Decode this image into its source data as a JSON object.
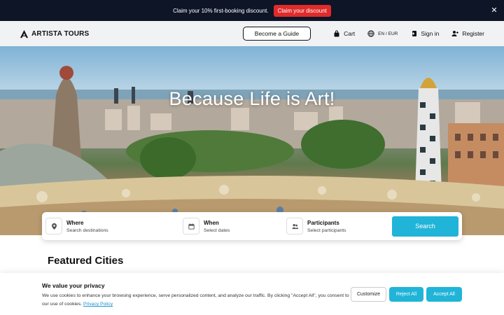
{
  "promo": {
    "text": "Claim your 10% first-booking discount.",
    "button": "Claim your discount",
    "close_icon": "close-icon"
  },
  "header": {
    "logo_text": "ARTISTA TOURS",
    "become_guide": "Become a Guide",
    "cart": "Cart",
    "locale": "EN / EUR",
    "sign_in": "Sign in",
    "register": "Register"
  },
  "hero": {
    "title": "Because Life is Art!"
  },
  "search": {
    "where_label": "Where",
    "where_sub": "Search destinations",
    "when_label": "When",
    "when_sub": "Select dates",
    "participants_label": "Participants",
    "participants_sub": "Select participants",
    "button": "Search"
  },
  "featured": {
    "title": "Featured Cities"
  },
  "cookie": {
    "title": "We value your privacy",
    "text": "We use cookies to enhance your browsing experience, serve personalized content, and analyze our traffic. By clicking \"Accept All\", you consent to our use of cookies.",
    "link": "Privacy Policy",
    "customize": "Customize",
    "reject": "Reject All",
    "accept": "Accept All"
  },
  "colors": {
    "accent": "#20b4d8",
    "promo_bg": "#0e1527",
    "promo_button": "#e02b2b"
  }
}
